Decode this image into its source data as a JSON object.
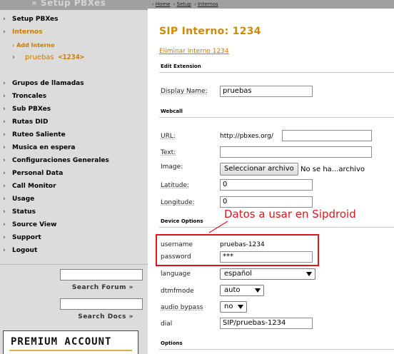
{
  "sidebar": {
    "header_title": "» Setup PBXes",
    "items": [
      {
        "label": "Setup PBXes"
      },
      {
        "label": "Internos"
      },
      {
        "label": "Grupos de llamadas"
      },
      {
        "label": "Troncales"
      },
      {
        "label": "Sub PBXes"
      },
      {
        "label": "Rutas DID"
      },
      {
        "label": "Ruteo Saliente"
      },
      {
        "label": "Musica en espera"
      },
      {
        "label": "Configuraciones Generales"
      },
      {
        "label": "Personal Data"
      },
      {
        "label": "Call Monitor"
      },
      {
        "label": "Usage"
      },
      {
        "label": "Status"
      },
      {
        "label": "Source View"
      },
      {
        "label": "Support"
      },
      {
        "label": "Logout"
      }
    ],
    "sub_add": "Add Interno",
    "sub_name": "pruebas",
    "sub_code": "<1234>",
    "search_forum": "Search Forum »",
    "search_docs": "Search Docs »",
    "premium": "PREMIUM ACCOUNT"
  },
  "breadcrumb": {
    "home": "Home",
    "setup": "Setup",
    "internos": "Internos",
    "arrow": "›"
  },
  "main": {
    "title": "SIP Interno: 1234",
    "delete_link": "Eliminar Interno 1234",
    "edit_extension": {
      "section": "Edit Extension",
      "display_name_label": "Display Name:",
      "display_name_value": "pruebas"
    },
    "webcall": {
      "section": "Webcall",
      "url_label": "URL:",
      "url_prefix": "http://pbxes.org/",
      "url_value": "",
      "text_label": "Text:",
      "text_value": "",
      "image_label": "Image:",
      "file_button": "Seleccionar archivo",
      "file_status": "No se ha...archivo",
      "latitude_label": "Latitude:",
      "latitude_value": "0",
      "longitude_label": "Longitude:",
      "longitude_value": "0"
    },
    "device_options": {
      "section": "Device Options",
      "username_label": "username",
      "username_value": "pruebas-1234",
      "password_label": "password",
      "password_value": "***",
      "language_label": "language",
      "language_value": "español",
      "dtmfmode_label": "dtmfmode",
      "dtmfmode_value": "auto",
      "audio_bypass_label": "audio bypass",
      "audio_bypass_value": "no",
      "dial_label": "dial",
      "dial_value": "SIP/pruebas-1234"
    },
    "options_section": "Options"
  },
  "annotation": {
    "text": "Datos a usar en Sipdroid",
    "color": "#e0141b"
  },
  "colors": {
    "accent": "#d08a08",
    "sidebar_bg": "#dcdcdc",
    "header_bg": "#a0a0a0"
  }
}
